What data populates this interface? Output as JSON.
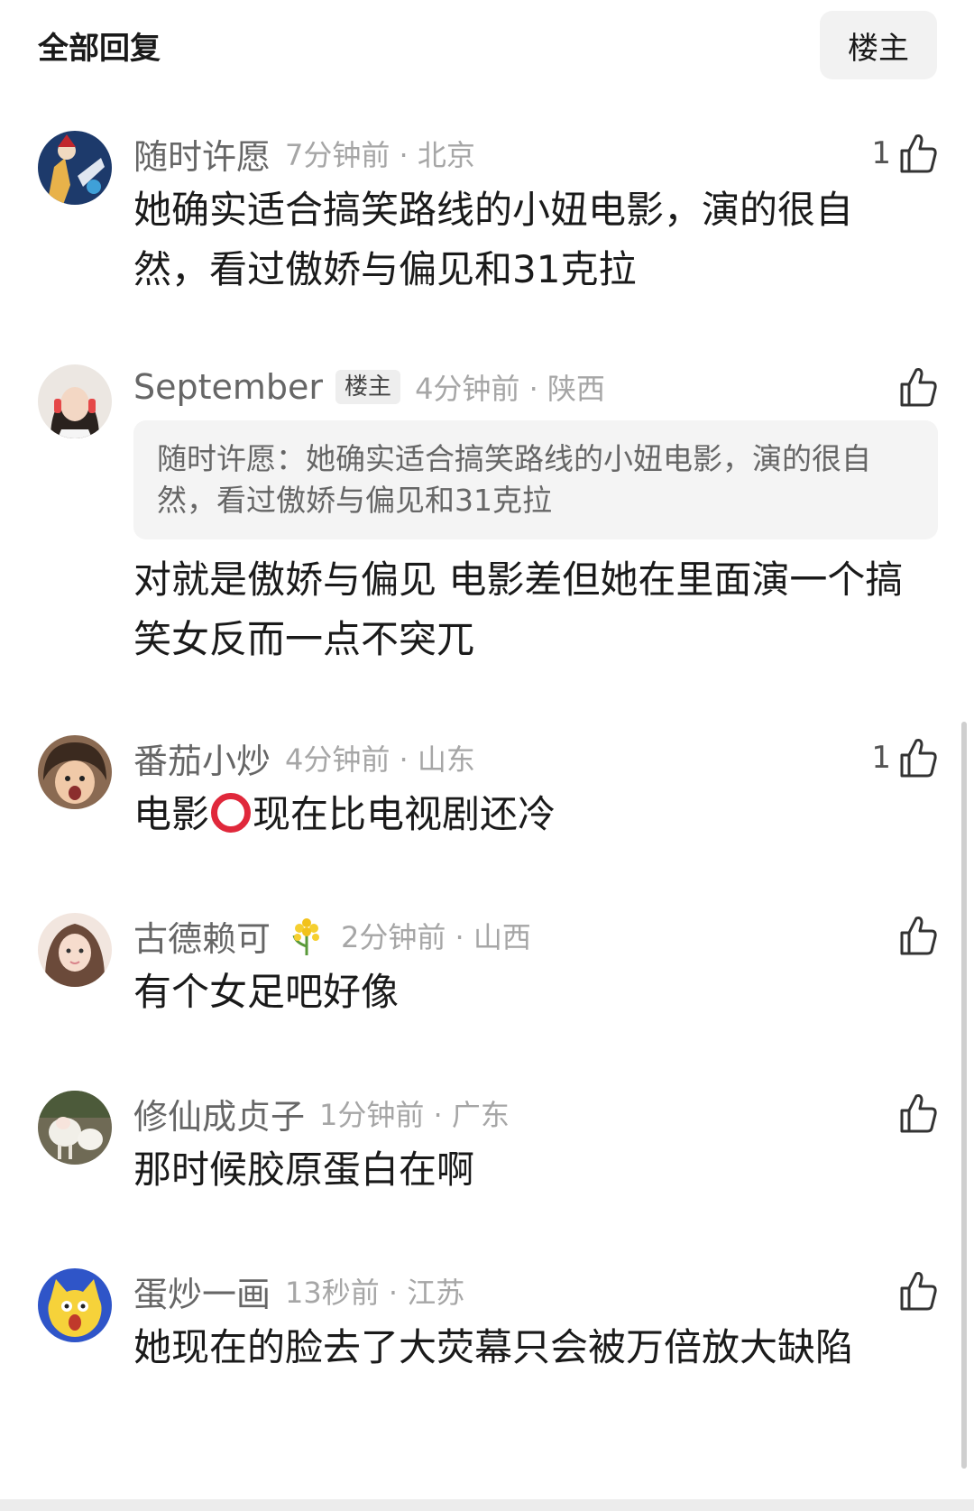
{
  "header": {
    "title": "全部回复",
    "filter_label": "楼主"
  },
  "comments": [
    {
      "username": "随时许愿",
      "time_location": "7分钟前 · 北京",
      "like_count": "1",
      "text": "她确实适合搞笑路线的小妞电影，演的很自然，看过傲娇与偏见和31克拉"
    },
    {
      "username": "September",
      "badge": "楼主",
      "time_location": "4分钟前 · 陕西",
      "like_count": "",
      "quote": "随时许愿：她确实适合搞笑路线的小妞电影，演的很自然，看过傲娇与偏见和31克拉",
      "text": "对就是傲娇与偏见 电影差但她在里面演一个搞笑女反而一点不突兀"
    },
    {
      "username": "番茄小炒",
      "time_location": "4分钟前 · 山东",
      "like_count": "1",
      "text_before": "电影",
      "text_after": "现在比电视剧还冷"
    },
    {
      "username": "古德赖可",
      "time_location": "2分钟前 · 山西",
      "like_count": "",
      "text": "有个女足吧好像"
    },
    {
      "username": "修仙成贞子",
      "time_location": "1分钟前 · 广东",
      "like_count": "",
      "text": "那时候胶原蛋白在啊"
    },
    {
      "username": "蛋炒一画",
      "time_location": "13秒前 · 江苏",
      "like_count": "",
      "text": "她现在的脸去了大荧幕只会被万倍放大缺陷"
    }
  ],
  "colors": {
    "accent_ring": "#e0283b",
    "meta_gray": "#a6a6a6",
    "quote_bg": "#f4f4f4"
  },
  "icons": [
    "thumbs-up-icon",
    "avatar",
    "flower-badge-icon",
    "red-circle-emoji-icon"
  ]
}
